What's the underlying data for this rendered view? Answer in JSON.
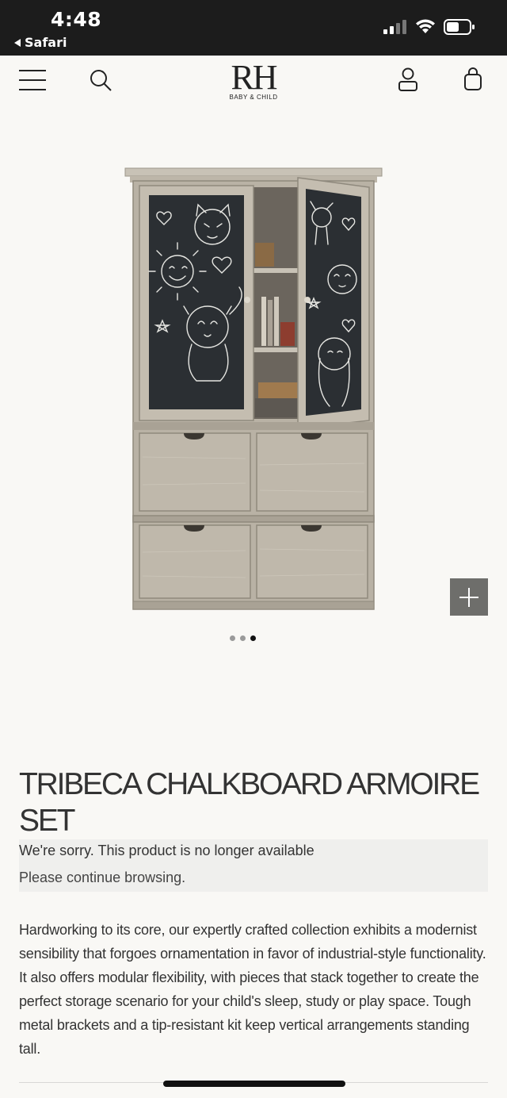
{
  "status_bar": {
    "time": "4:48",
    "back_label": "Safari",
    "icons": [
      "signal-icon",
      "wifi-icon",
      "battery-icon"
    ]
  },
  "header": {
    "logo_text": "RH",
    "logo_subtext": "BABY & CHILD",
    "icons": [
      "menu-icon",
      "search-icon",
      "account-icon",
      "cart-icon"
    ]
  },
  "product": {
    "image_alt": "Tribeca chalkboard armoire set",
    "carousel": {
      "total": 3,
      "active": 3
    },
    "title": "TRIBECA CHALKBOARD ARMOIRE SET",
    "notice_line1": "We're sorry. This product is no longer available",
    "notice_line2": "Please continue browsing.",
    "description": "Hardworking to its core, our expertly crafted collection exhibits a modernist sensibility that forgoes ornamentation in favor of industrial-style functionality. It also offers modular flexibility, with pieces that stack together to create the perfect storage scenario for your child's sleep, study or play space. Tough metal brackets and a tip-resistant kit keep vertical arrangements standing tall."
  },
  "colors": {
    "background": "#f9f8f5",
    "status_bar": "#1c1c1c",
    "zoom_button": "#6e6e6b",
    "notice_bg": "#efefed",
    "wood": "#b9b2a5",
    "chalkboard": "#2b2f33"
  }
}
